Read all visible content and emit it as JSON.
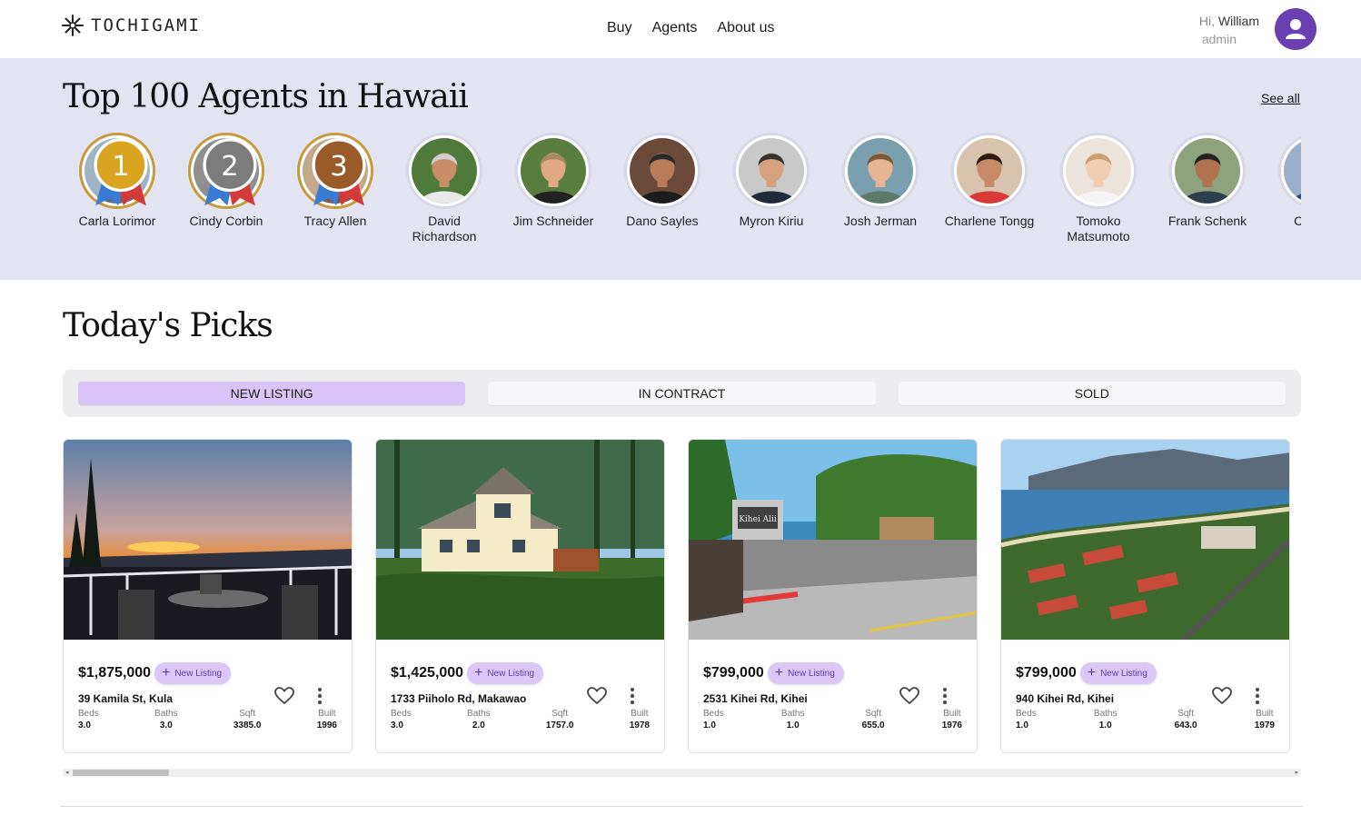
{
  "brand": {
    "name": "TOCHIGAMI",
    "accent": "#6a3fb1",
    "tab_active": "#d9c4f7"
  },
  "nav": {
    "items": [
      "Buy",
      "Agents",
      "About us"
    ]
  },
  "user": {
    "greeting": "Hi,",
    "name": "William",
    "role": "admin"
  },
  "agents": {
    "title": "Top 100 Agents in Hawaii",
    "see_all": "See all",
    "list": [
      {
        "name": "Carla Lorimor",
        "rank": "1"
      },
      {
        "name": "Cindy Corbin",
        "rank": "2"
      },
      {
        "name": "Tracy Allen",
        "rank": "3"
      },
      {
        "name": "David Richardson"
      },
      {
        "name": "Jim Schneider"
      },
      {
        "name": "Dano Sayles"
      },
      {
        "name": "Myron Kiriu"
      },
      {
        "name": "Josh Jerman"
      },
      {
        "name": "Charlene Tongg"
      },
      {
        "name": "Tomoko Matsumoto"
      },
      {
        "name": "Frank Schenk"
      },
      {
        "name": "Ca Nich"
      }
    ]
  },
  "picks": {
    "title": "Today's Picks",
    "tabs": [
      "NEW LISTING",
      "IN CONTRACT",
      "SOLD"
    ],
    "active_tab": "NEW LISTING",
    "stat_labels": {
      "beds": "Beds",
      "baths": "Baths",
      "sqft": "Sqft",
      "built": "Built"
    },
    "listings": [
      {
        "price": "$1,875,000",
        "badge": "New Listing",
        "address": "39 Kamila St, Kula",
        "beds": "3.0",
        "baths": "3.0",
        "sqft": "3385.0",
        "built": "1996"
      },
      {
        "price": "$1,425,000",
        "badge": "New Listing",
        "address": "1733 Piiholo Rd, Makawao",
        "beds": "3.0",
        "baths": "2.0",
        "sqft": "1757.0",
        "built": "1978"
      },
      {
        "price": "$799,000",
        "badge": "New Listing",
        "address": "2531 Kihei Rd, Kihei",
        "beds": "1.0",
        "baths": "1.0",
        "sqft": "655.0",
        "built": "1976"
      },
      {
        "price": "$799,000",
        "badge": "New Listing",
        "address": "940 Kihei Rd, Kihei",
        "beds": "1.0",
        "baths": "1.0",
        "sqft": "643.0",
        "built": "1979"
      }
    ]
  },
  "listing_photo_text": "Kihei Alii"
}
